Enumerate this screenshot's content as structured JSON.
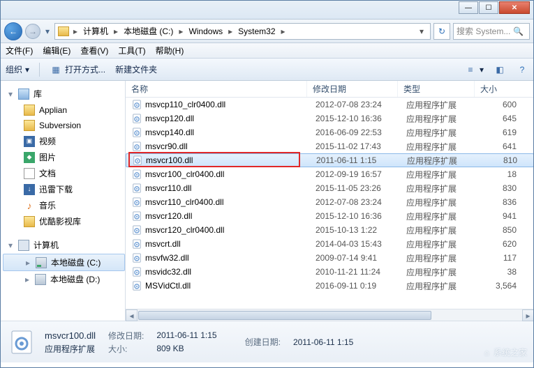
{
  "breadcrumb": {
    "p0": "计算机",
    "p1": "本地磁盘 (C:)",
    "p2": "Windows",
    "p3": "System32"
  },
  "search": {
    "placeholder": "搜索 System..."
  },
  "menu": {
    "file": "文件(F)",
    "edit": "编辑(E)",
    "view": "查看(V)",
    "tools": "工具(T)",
    "help": "帮助(H)"
  },
  "cmd": {
    "organize": "组织",
    "openwith": "打开方式...",
    "newfolder": "新建文件夹"
  },
  "nav": {
    "libraries": "库",
    "applian": "Applian",
    "subversion": "Subversion",
    "video": "视频",
    "pictures": "图片",
    "documents": "文档",
    "xunlei": "迅雷下载",
    "music": "音乐",
    "youku": "优酷影视库",
    "computer": "计算机",
    "drive_c": "本地磁盘 (C:)",
    "drive_d": "本地磁盘 (D:)"
  },
  "cols": {
    "name": "名称",
    "date": "修改日期",
    "type": "类型",
    "size": "大小"
  },
  "type_label": "应用程序扩展",
  "files": [
    {
      "n": "msvcp110_clr0400.dll",
      "d": "2012-07-08 23:24",
      "s": "600"
    },
    {
      "n": "msvcp120.dll",
      "d": "2015-12-10 16:36",
      "s": "645"
    },
    {
      "n": "msvcp140.dll",
      "d": "2016-06-09 22:53",
      "s": "619"
    },
    {
      "n": "msvcr90.dll",
      "d": "2015-11-02 17:43",
      "s": "641"
    },
    {
      "n": "msvcr100.dll",
      "d": "2011-06-11 1:15",
      "s": "810"
    },
    {
      "n": "msvcr100_clr0400.dll",
      "d": "2012-09-19 16:57",
      "s": "18"
    },
    {
      "n": "msvcr110.dll",
      "d": "2015-11-05 23:26",
      "s": "830"
    },
    {
      "n": "msvcr110_clr0400.dll",
      "d": "2012-07-08 23:24",
      "s": "836"
    },
    {
      "n": "msvcr120.dll",
      "d": "2015-12-10 16:36",
      "s": "941"
    },
    {
      "n": "msvcr120_clr0400.dll",
      "d": "2015-10-13 1:22",
      "s": "850"
    },
    {
      "n": "msvcrt.dll",
      "d": "2014-04-03 15:43",
      "s": "620"
    },
    {
      "n": "msvfw32.dll",
      "d": "2009-07-14 9:41",
      "s": "117"
    },
    {
      "n": "msvidc32.dll",
      "d": "2010-11-21 11:24",
      "s": "38"
    },
    {
      "n": "MSVidCtl.dll",
      "d": "2016-09-11 0:19",
      "s": "3,564"
    }
  ],
  "details": {
    "filename": "msvcr100.dll",
    "type": "应用程序扩展",
    "mod_label": "修改日期:",
    "mod_val": "2011-06-11 1:15",
    "size_label": "大小:",
    "size_val": "809 KB",
    "created_label": "创建日期:",
    "created_val": "2011-06-11 1:15"
  },
  "watermark": "系统之家"
}
